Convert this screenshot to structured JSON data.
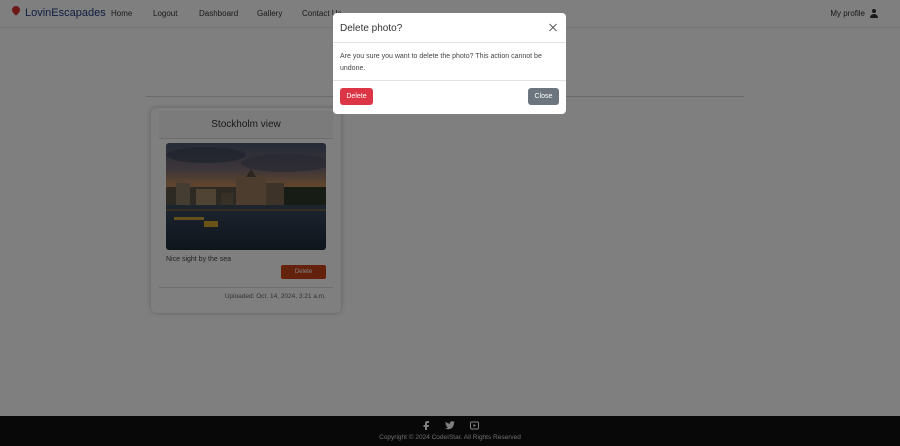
{
  "nav": {
    "brand": "LovinEscapades",
    "links": [
      "Home",
      "Logout",
      "Dashboard",
      "Gallery",
      "Contact Us"
    ],
    "profile": "My profile"
  },
  "card": {
    "title": "Stockholm view",
    "caption": "Nice sight by the sea",
    "delete_label": "Delete",
    "uploaded": "Uploaded: Oct. 14, 2024, 3:21 a.m."
  },
  "footer": {
    "socials": [
      "facebook-icon",
      "twitter-icon",
      "youtube-icon"
    ],
    "copyright": "Copyright © 2024 CodeIStar. All Rights Reserved"
  },
  "modal": {
    "title": "Delete photo?",
    "body": "Are you sure you want to delete the photo? This action cannot be undone.",
    "delete_label": "Delete",
    "close_label": "Close"
  },
  "colors": {
    "brand": "#1f3c82",
    "danger": "#dc3545",
    "secondary": "#6c757d",
    "card_delete": "#c9451b"
  }
}
